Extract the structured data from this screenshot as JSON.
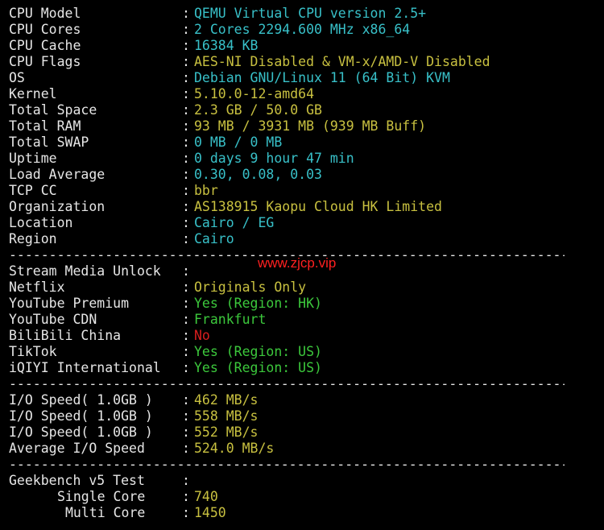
{
  "system": [
    {
      "label": "CPU Model",
      "value": "QEMU Virtual CPU version 2.5+",
      "color": "cyan"
    },
    {
      "label": "CPU Cores",
      "value": "2 Cores 2294.600 MHz x86_64",
      "color": "cyan"
    },
    {
      "label": "CPU Cache",
      "value": "16384 KB",
      "color": "cyan"
    },
    {
      "label": "CPU Flags",
      "value": "AES-NI Disabled & VM-x/AMD-V Disabled",
      "color": "yellow"
    },
    {
      "label": "OS",
      "value": "Debian GNU/Linux 11 (64 Bit) KVM",
      "color": "cyan"
    },
    {
      "label": "Kernel",
      "value": "5.10.0-12-amd64",
      "color": "yellow"
    },
    {
      "label": "Total Space",
      "value": "2.3 GB / 50.0 GB",
      "color": "yellow"
    },
    {
      "label": "Total RAM",
      "value": "93 MB / 3931 MB (939 MB Buff)",
      "color": "yellow"
    },
    {
      "label": "Total SWAP",
      "value": "0 MB / 0 MB",
      "color": "cyan"
    },
    {
      "label": "Uptime",
      "value": "0 days 9 hour 47 min",
      "color": "cyan"
    },
    {
      "label": "Load Average",
      "value": "0.30, 0.08, 0.03",
      "color": "cyan"
    },
    {
      "label": "TCP CC",
      "value": "bbr",
      "color": "yellow"
    },
    {
      "label": "Organization",
      "value": "AS138915 Kaopu Cloud HK Limited",
      "color": "yellow"
    },
    {
      "label": "Location",
      "value": "Cairo / EG",
      "color": "cyan"
    },
    {
      "label": "Region",
      "value": "Cairo",
      "color": "cyan"
    }
  ],
  "separator": "----------------------------------------------------------------------",
  "watermark": "www.zjcp.vip",
  "media": [
    {
      "label": "Stream Media Unlock",
      "value": "",
      "color": "cyan"
    },
    {
      "label": "Netflix",
      "value": "Originals Only",
      "color": "yellow"
    },
    {
      "label": "YouTube Premium",
      "value": "Yes (Region: HK)",
      "color": "green"
    },
    {
      "label": "YouTube CDN",
      "value": "Frankfurt",
      "color": "green"
    },
    {
      "label": "BiliBili China",
      "value": "No",
      "color": "red"
    },
    {
      "label": "TikTok",
      "value": "Yes (Region: US)",
      "color": "green"
    },
    {
      "label": "iQIYI International",
      "value": "Yes (Region: US)",
      "color": "green"
    }
  ],
  "io": [
    {
      "label": "I/O Speed( 1.0GB )",
      "value": "462 MB/s",
      "color": "yellow"
    },
    {
      "label": "I/O Speed( 1.0GB )",
      "value": "558 MB/s",
      "color": "yellow"
    },
    {
      "label": "I/O Speed( 1.0GB )",
      "value": "552 MB/s",
      "color": "yellow"
    },
    {
      "label": "Average I/O Speed",
      "value": "524.0 MB/s",
      "color": "yellow"
    }
  ],
  "geekbench": {
    "title": "Geekbench v5 Test",
    "single_label": "Single Core",
    "single_value": "740",
    "multi_label": "Multi Core",
    "multi_value": "1450",
    "value_color": "yellow"
  },
  "colon": ":",
  "colors": {
    "cyan": "#38c0c8",
    "yellow": "#c8c040",
    "green": "#3cc83c",
    "red": "#d81e1e",
    "text": "#e6e6e6",
    "background": "#000000",
    "watermark": "#ff2020"
  }
}
